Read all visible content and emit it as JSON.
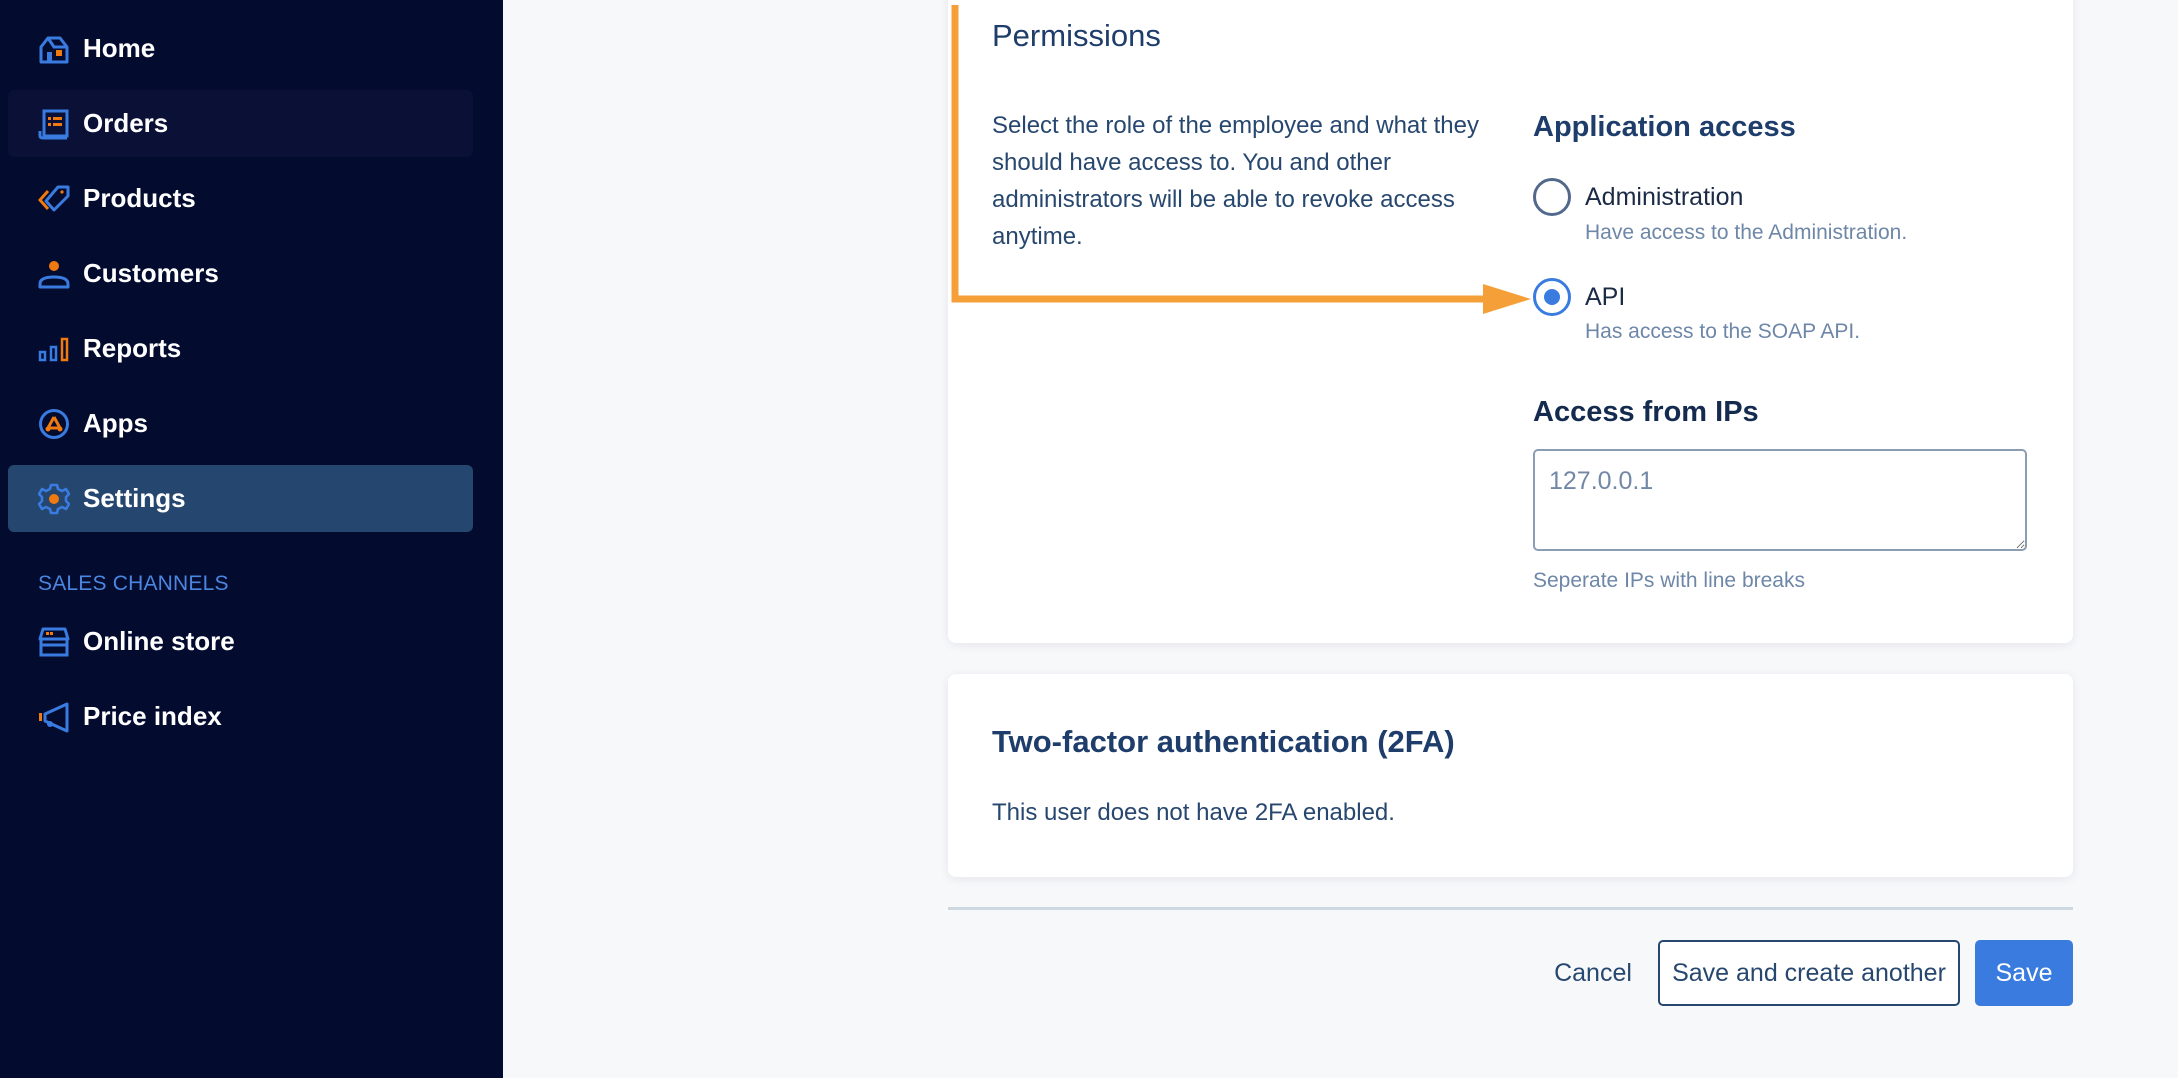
{
  "sidebar": {
    "items": [
      {
        "label": "Home",
        "icon": "home-icon"
      },
      {
        "label": "Orders",
        "icon": "orders-icon",
        "state": "hover"
      },
      {
        "label": "Products",
        "icon": "tag-icon"
      },
      {
        "label": "Customers",
        "icon": "user-icon"
      },
      {
        "label": "Reports",
        "icon": "bar-chart-icon"
      },
      {
        "label": "Apps",
        "icon": "apps-icon"
      },
      {
        "label": "Settings",
        "icon": "gear-icon",
        "state": "active"
      }
    ],
    "section_label": "SALES CHANNELS",
    "channels": [
      {
        "label": "Online store",
        "icon": "store-icon"
      },
      {
        "label": "Price index",
        "icon": "megaphone-icon"
      }
    ]
  },
  "permissions": {
    "title": "Permissions",
    "description": "Select the role of the employee and what they should have access to. You and other administrators will be able to revoke access anytime.",
    "application_access": {
      "heading": "Application access",
      "options": [
        {
          "label": "Administration",
          "help": "Have access to the Administration.",
          "checked": false
        },
        {
          "label": "API",
          "help": "Has access to the SOAP API.",
          "checked": true
        }
      ]
    },
    "ip_access": {
      "heading": "Access from IPs",
      "value": "",
      "placeholder": "127.0.0.1",
      "hint": "Seperate IPs with line breaks"
    }
  },
  "two_factor": {
    "title": "Two-factor authentication (2FA)",
    "status_text": "This user does not have 2FA enabled."
  },
  "actions": {
    "cancel_label": "Cancel",
    "save_another_label": "Save and create another",
    "save_label": "Save"
  },
  "colors": {
    "sidebar_bg": "#030b2f",
    "active_item_bg": "#25466f",
    "accent_blue": "#3a7be0",
    "icon_orange": "#f07a10",
    "annotation_orange": "#f59f38"
  }
}
